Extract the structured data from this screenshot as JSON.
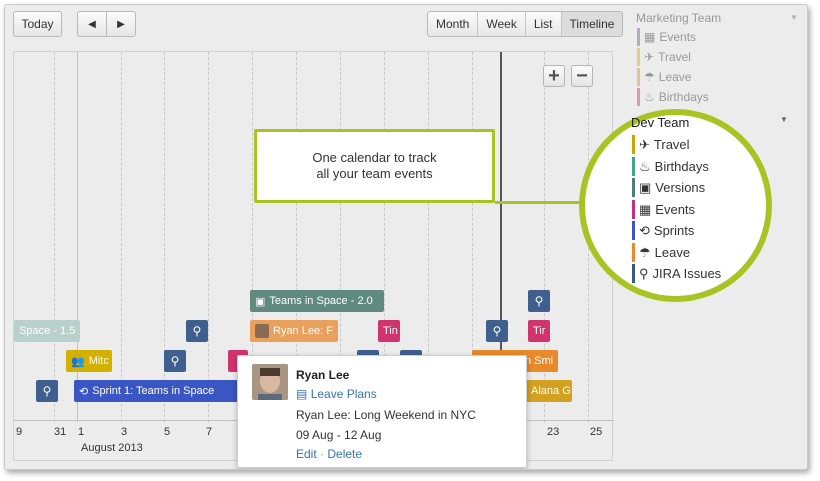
{
  "toolbar": {
    "today_label": "Today",
    "prev_glyph": "◀",
    "next_glyph": "▶",
    "views": [
      "Month",
      "Week",
      "List",
      "Timeline"
    ],
    "active_view": "Timeline"
  },
  "zoom": {
    "in_glyph": "+",
    "out_glyph": "−"
  },
  "axis": {
    "ticks": [
      "9",
      "31",
      "1",
      "3",
      "5",
      "7",
      "23",
      "25"
    ],
    "month_label": "August 2013"
  },
  "events": {
    "teams_in_space": "Teams in Space - 2.0",
    "space_15": "Space - 1.5",
    "ryan_lee": "Ryan Lee: F",
    "tin_1": "Tin",
    "tin_2": "Tir",
    "mitc": "Mitc",
    "sprint": "Sprint 1: Teams in Space",
    "m_smi": "n Smi",
    "alana": "Alana G"
  },
  "callout": {
    "line1": "One calendar to track",
    "line2": "all your team events"
  },
  "popup": {
    "name": "Ryan Lee",
    "type_link": "Leave Plans",
    "title": "Ryan Lee: Long Weekend in NYC",
    "dates": "09 Aug - 12 Aug",
    "edit": "Edit",
    "separator": "·",
    "delete": "Delete"
  },
  "sidebar": {
    "marketing": {
      "title": "Marketing Team",
      "items": [
        {
          "label": "Events",
          "icon": "calendar-icon",
          "color": "#7b5a8c"
        },
        {
          "label": "Travel",
          "icon": "plane-icon",
          "color": "#d4b000"
        },
        {
          "label": "Leave",
          "icon": "beach-icon",
          "color": "#e8892a"
        },
        {
          "label": "Birthdays",
          "icon": "cake-icon",
          "color": "#d0336e"
        }
      ]
    },
    "dev": {
      "title": "Dev Team",
      "items": [
        {
          "label": "Travel",
          "icon": "plane-icon",
          "color": "#c9a400"
        },
        {
          "label": "Birthdays",
          "icon": "cake-icon",
          "color": "#3fa58c"
        },
        {
          "label": "Versions",
          "icon": "box-icon",
          "color": "#527c7a"
        },
        {
          "label": "Events",
          "icon": "calendar-icon",
          "color": "#c4307a"
        },
        {
          "label": "Sprints",
          "icon": "sprint-icon",
          "color": "#3a55c4"
        },
        {
          "label": "Leave",
          "icon": "beach-icon",
          "color": "#e8892a"
        },
        {
          "label": "JIRA Issues",
          "icon": "bug-icon",
          "color": "#345a8c"
        }
      ]
    }
  },
  "colors": {
    "accent_ring": "#a8c423",
    "event_teal": "#5f8a7e",
    "event_orange": "#e8892a",
    "event_pink": "#d0336e",
    "event_blue": "#3f5f8f",
    "event_sprint": "#3a55c4"
  }
}
